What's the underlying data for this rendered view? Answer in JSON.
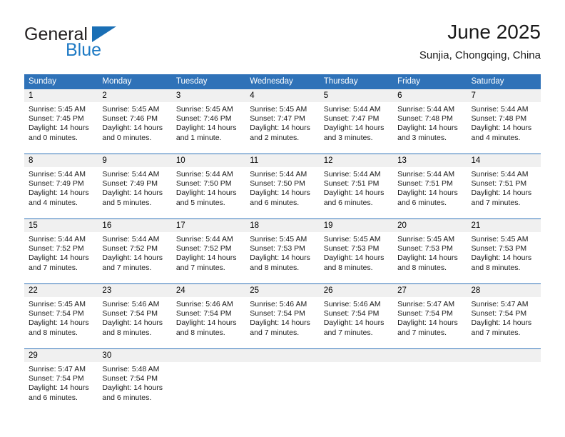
{
  "brand": {
    "general": "General",
    "blue": "Blue",
    "triangle_color": "#1a6fb5",
    "blue_text_color": "#1e7ac4"
  },
  "header": {
    "title": "June 2025",
    "subtitle": "Sunjia, Chongqing, China"
  },
  "theme": {
    "header_blue": "#2f72b8",
    "daynum_band": "#f0f0f0",
    "text": "#1a1a1a"
  },
  "weekdays": [
    "Sunday",
    "Monday",
    "Tuesday",
    "Wednesday",
    "Thursday",
    "Friday",
    "Saturday"
  ],
  "weeks": [
    {
      "days": [
        {
          "day": "1",
          "sunrise": "Sunrise: 5:45 AM",
          "sunset": "Sunset: 7:45 PM",
          "daylight1": "Daylight: 14 hours",
          "daylight2": "and 0 minutes."
        },
        {
          "day": "2",
          "sunrise": "Sunrise: 5:45 AM",
          "sunset": "Sunset: 7:46 PM",
          "daylight1": "Daylight: 14 hours",
          "daylight2": "and 0 minutes."
        },
        {
          "day": "3",
          "sunrise": "Sunrise: 5:45 AM",
          "sunset": "Sunset: 7:46 PM",
          "daylight1": "Daylight: 14 hours",
          "daylight2": "and 1 minute."
        },
        {
          "day": "4",
          "sunrise": "Sunrise: 5:45 AM",
          "sunset": "Sunset: 7:47 PM",
          "daylight1": "Daylight: 14 hours",
          "daylight2": "and 2 minutes."
        },
        {
          "day": "5",
          "sunrise": "Sunrise: 5:44 AM",
          "sunset": "Sunset: 7:47 PM",
          "daylight1": "Daylight: 14 hours",
          "daylight2": "and 3 minutes."
        },
        {
          "day": "6",
          "sunrise": "Sunrise: 5:44 AM",
          "sunset": "Sunset: 7:48 PM",
          "daylight1": "Daylight: 14 hours",
          "daylight2": "and 3 minutes."
        },
        {
          "day": "7",
          "sunrise": "Sunrise: 5:44 AM",
          "sunset": "Sunset: 7:48 PM",
          "daylight1": "Daylight: 14 hours",
          "daylight2": "and 4 minutes."
        }
      ]
    },
    {
      "days": [
        {
          "day": "8",
          "sunrise": "Sunrise: 5:44 AM",
          "sunset": "Sunset: 7:49 PM",
          "daylight1": "Daylight: 14 hours",
          "daylight2": "and 4 minutes."
        },
        {
          "day": "9",
          "sunrise": "Sunrise: 5:44 AM",
          "sunset": "Sunset: 7:49 PM",
          "daylight1": "Daylight: 14 hours",
          "daylight2": "and 5 minutes."
        },
        {
          "day": "10",
          "sunrise": "Sunrise: 5:44 AM",
          "sunset": "Sunset: 7:50 PM",
          "daylight1": "Daylight: 14 hours",
          "daylight2": "and 5 minutes."
        },
        {
          "day": "11",
          "sunrise": "Sunrise: 5:44 AM",
          "sunset": "Sunset: 7:50 PM",
          "daylight1": "Daylight: 14 hours",
          "daylight2": "and 6 minutes."
        },
        {
          "day": "12",
          "sunrise": "Sunrise: 5:44 AM",
          "sunset": "Sunset: 7:51 PM",
          "daylight1": "Daylight: 14 hours",
          "daylight2": "and 6 minutes."
        },
        {
          "day": "13",
          "sunrise": "Sunrise: 5:44 AM",
          "sunset": "Sunset: 7:51 PM",
          "daylight1": "Daylight: 14 hours",
          "daylight2": "and 6 minutes."
        },
        {
          "day": "14",
          "sunrise": "Sunrise: 5:44 AM",
          "sunset": "Sunset: 7:51 PM",
          "daylight1": "Daylight: 14 hours",
          "daylight2": "and 7 minutes."
        }
      ]
    },
    {
      "days": [
        {
          "day": "15",
          "sunrise": "Sunrise: 5:44 AM",
          "sunset": "Sunset: 7:52 PM",
          "daylight1": "Daylight: 14 hours",
          "daylight2": "and 7 minutes."
        },
        {
          "day": "16",
          "sunrise": "Sunrise: 5:44 AM",
          "sunset": "Sunset: 7:52 PM",
          "daylight1": "Daylight: 14 hours",
          "daylight2": "and 7 minutes."
        },
        {
          "day": "17",
          "sunrise": "Sunrise: 5:44 AM",
          "sunset": "Sunset: 7:52 PM",
          "daylight1": "Daylight: 14 hours",
          "daylight2": "and 7 minutes."
        },
        {
          "day": "18",
          "sunrise": "Sunrise: 5:45 AM",
          "sunset": "Sunset: 7:53 PM",
          "daylight1": "Daylight: 14 hours",
          "daylight2": "and 8 minutes."
        },
        {
          "day": "19",
          "sunrise": "Sunrise: 5:45 AM",
          "sunset": "Sunset: 7:53 PM",
          "daylight1": "Daylight: 14 hours",
          "daylight2": "and 8 minutes."
        },
        {
          "day": "20",
          "sunrise": "Sunrise: 5:45 AM",
          "sunset": "Sunset: 7:53 PM",
          "daylight1": "Daylight: 14 hours",
          "daylight2": "and 8 minutes."
        },
        {
          "day": "21",
          "sunrise": "Sunrise: 5:45 AM",
          "sunset": "Sunset: 7:53 PM",
          "daylight1": "Daylight: 14 hours",
          "daylight2": "and 8 minutes."
        }
      ]
    },
    {
      "days": [
        {
          "day": "22",
          "sunrise": "Sunrise: 5:45 AM",
          "sunset": "Sunset: 7:54 PM",
          "daylight1": "Daylight: 14 hours",
          "daylight2": "and 8 minutes."
        },
        {
          "day": "23",
          "sunrise": "Sunrise: 5:46 AM",
          "sunset": "Sunset: 7:54 PM",
          "daylight1": "Daylight: 14 hours",
          "daylight2": "and 8 minutes."
        },
        {
          "day": "24",
          "sunrise": "Sunrise: 5:46 AM",
          "sunset": "Sunset: 7:54 PM",
          "daylight1": "Daylight: 14 hours",
          "daylight2": "and 8 minutes."
        },
        {
          "day": "25",
          "sunrise": "Sunrise: 5:46 AM",
          "sunset": "Sunset: 7:54 PM",
          "daylight1": "Daylight: 14 hours",
          "daylight2": "and 7 minutes."
        },
        {
          "day": "26",
          "sunrise": "Sunrise: 5:46 AM",
          "sunset": "Sunset: 7:54 PM",
          "daylight1": "Daylight: 14 hours",
          "daylight2": "and 7 minutes."
        },
        {
          "day": "27",
          "sunrise": "Sunrise: 5:47 AM",
          "sunset": "Sunset: 7:54 PM",
          "daylight1": "Daylight: 14 hours",
          "daylight2": "and 7 minutes."
        },
        {
          "day": "28",
          "sunrise": "Sunrise: 5:47 AM",
          "sunset": "Sunset: 7:54 PM",
          "daylight1": "Daylight: 14 hours",
          "daylight2": "and 7 minutes."
        }
      ]
    },
    {
      "days": [
        {
          "day": "29",
          "sunrise": "Sunrise: 5:47 AM",
          "sunset": "Sunset: 7:54 PM",
          "daylight1": "Daylight: 14 hours",
          "daylight2": "and 6 minutes."
        },
        {
          "day": "30",
          "sunrise": "Sunrise: 5:48 AM",
          "sunset": "Sunset: 7:54 PM",
          "daylight1": "Daylight: 14 hours",
          "daylight2": "and 6 minutes."
        },
        {
          "day": "",
          "sunrise": "",
          "sunset": "",
          "daylight1": "",
          "daylight2": ""
        },
        {
          "day": "",
          "sunrise": "",
          "sunset": "",
          "daylight1": "",
          "daylight2": ""
        },
        {
          "day": "",
          "sunrise": "",
          "sunset": "",
          "daylight1": "",
          "daylight2": ""
        },
        {
          "day": "",
          "sunrise": "",
          "sunset": "",
          "daylight1": "",
          "daylight2": ""
        },
        {
          "day": "",
          "sunrise": "",
          "sunset": "",
          "daylight1": "",
          "daylight2": ""
        }
      ]
    }
  ]
}
